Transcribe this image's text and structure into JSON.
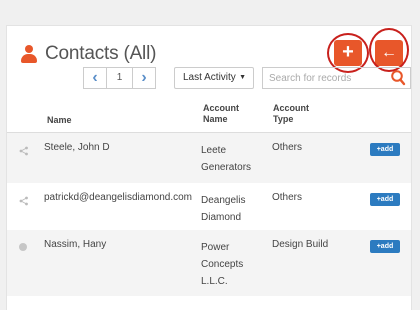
{
  "header": {
    "title": "Contacts (All)",
    "add_label": "+",
    "back_label": "←"
  },
  "toolbar": {
    "prev_label": "‹",
    "page": "1",
    "next_label": "›",
    "sort_value": "Last Activity",
    "search_placeholder": "Search for records"
  },
  "table": {
    "columns": {
      "name": "Name",
      "account_name_1": "Account",
      "account_name_2": "Name",
      "account_type_1": "Account",
      "account_type_2": "Type"
    },
    "rows": [
      {
        "icon": "share-icon",
        "name": "Steele, John D",
        "account_lines": [
          "Leete",
          "Generators"
        ],
        "type": "Others",
        "action": "+add"
      },
      {
        "icon": "share-icon",
        "name": "patrickd@deangelisdiamond.com",
        "account_lines": [
          "Deangelis",
          "Diamond"
        ],
        "type": "Others",
        "action": "+add"
      },
      {
        "icon": "dot-icon",
        "name": "Nassim, Hany",
        "account_lines": [
          "Power",
          "Concepts",
          "L.L.C."
        ],
        "type": "Design Build",
        "action": "+add"
      }
    ]
  },
  "colors": {
    "accent": "#e8572a",
    "highlight_circle": "#c8201c",
    "add_badge": "#2c7bc0",
    "pager_arrow": "#5b8fc9"
  }
}
